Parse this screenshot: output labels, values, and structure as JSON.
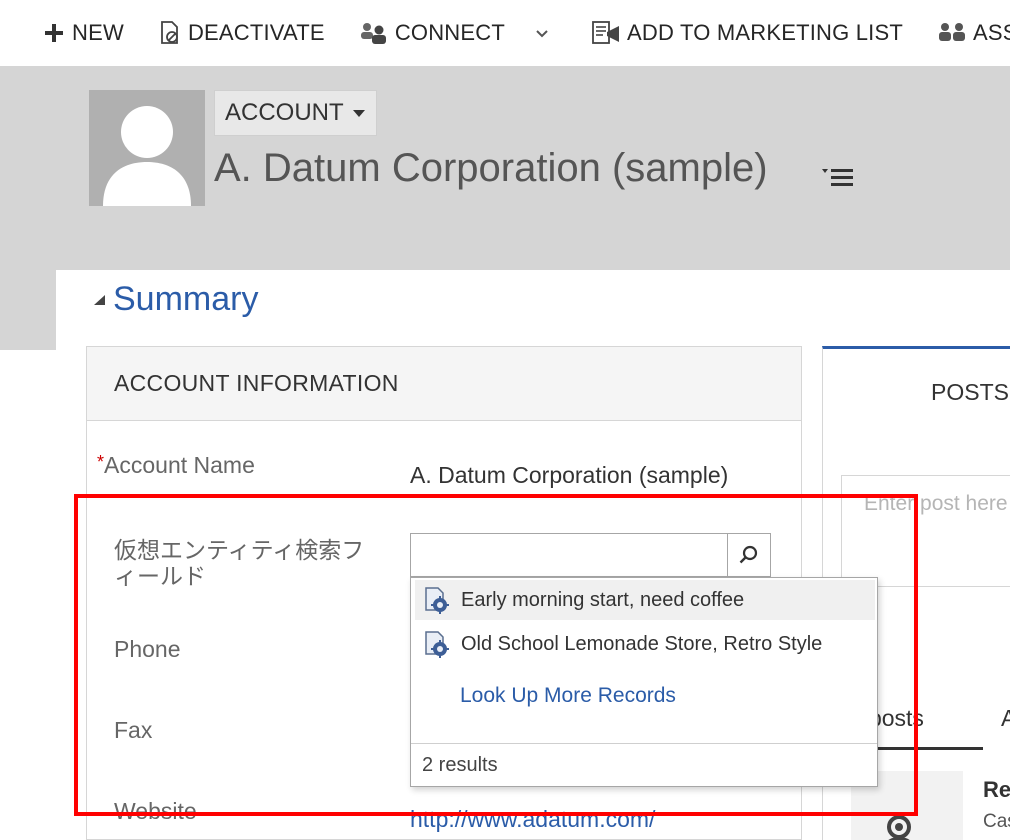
{
  "command_bar": {
    "new_label": "NEW",
    "deactivate_label": "DEACTIVATE",
    "connect_label": "CONNECT",
    "add_to_marketing_list_label": "ADD TO MARKETING LIST",
    "assign_label": "ASSIGN"
  },
  "header": {
    "entity_label": "ACCOUNT",
    "record_title": "A. Datum Corporation (sample)"
  },
  "summary": {
    "title": "Summary"
  },
  "account_information": {
    "section_title": "ACCOUNT INFORMATION",
    "account_name_label": "Account Name",
    "account_name_value": "A. Datum Corporation (sample)",
    "virtual_lookup_label": "仮想エンティティ検索フィールド",
    "virtual_lookup_value": "",
    "phone_label": "Phone",
    "fax_label": "Fax",
    "website_label": "Website",
    "website_value": "http://www.adatum.com/"
  },
  "lookup_flyout": {
    "results": [
      {
        "label": "Early morning start, need coffee"
      },
      {
        "label": "Old School Lemonade Store, Retro Style"
      }
    ],
    "more_label": "Look Up More Records",
    "count_label": "2 results"
  },
  "posts": {
    "title": "POSTS",
    "placeholder": "Enter post here",
    "tab_all": "All posts",
    "tab_auto": "A",
    "post_author": "Re",
    "post_sub": "Cas"
  },
  "colors": {
    "accent": "#2b5ca8",
    "header_band": "#d5d5d5",
    "highlight": "#ff0000",
    "required": "#cc0000"
  }
}
